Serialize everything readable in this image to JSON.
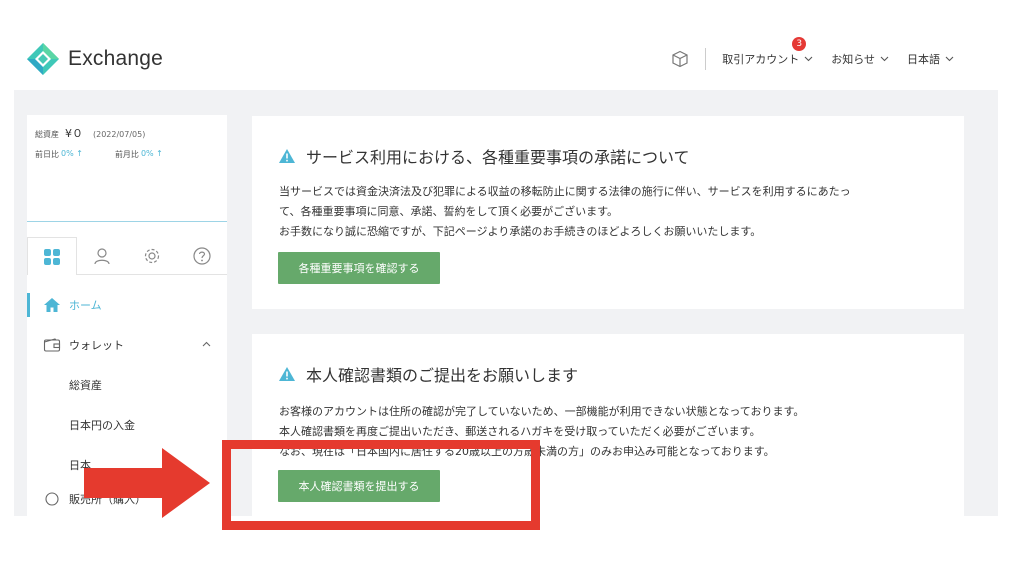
{
  "header": {
    "logo_text": "Exchange",
    "account_label": "取引アカウント",
    "account_badge": "3",
    "news_label": "お知らせ",
    "language_label": "日本語"
  },
  "sidebar": {
    "total_assets_label": "総資産",
    "total_assets_value": "¥０",
    "date": "(2022/07/05)",
    "daily_label": "前日比",
    "daily_value": "0% ↑",
    "monthly_label": "前月比",
    "monthly_value": "0% ↑",
    "tabs": [
      "grid-icon",
      "user-icon",
      "gear-icon",
      "help-icon"
    ],
    "nav": {
      "home": "ホーム",
      "wallet": "ウォレット",
      "total_assets": "総資産",
      "jpy_deposit": "日本円の入金",
      "partial_item": "日本",
      "sales_partial": "販売所（購入）"
    }
  },
  "card1": {
    "title": "サービス利用における、各種重要事項の承諾について",
    "body": [
      "当サービスでは資金決済法及び犯罪による収益の移転防止に関する法律の施行に伴い、サービスを利用するにあたっ",
      "て、各種重要事項に同意、承諾、誓約をして頂く必要がございます。",
      "お手数になり誠に恐縮ですが、下記ページより承諾のお手続きのほどよろしくお願いいたします。"
    ],
    "button": "各種重要事項を確認する"
  },
  "card2": {
    "title": "本人確認書類のご提出をお願いします",
    "body": [
      "お客様のアカウントは住所の確認が完了していないため、一部機能が利用できない状態となっております。",
      "本人確認書類を再度ご提出いただき、郵送されるハガキを受け取っていただく必要がございます。",
      "なお、現在は「日本国内に居住する20歳以上の方歳未満の方」のみお申込み可能となっております。"
    ],
    "button": "本人確認書類を提出する"
  },
  "colors": {
    "accent": "#4db6d5",
    "button_green": "#66a96b",
    "annotation_red": "#e53a2e",
    "badge_red": "#e53935"
  }
}
